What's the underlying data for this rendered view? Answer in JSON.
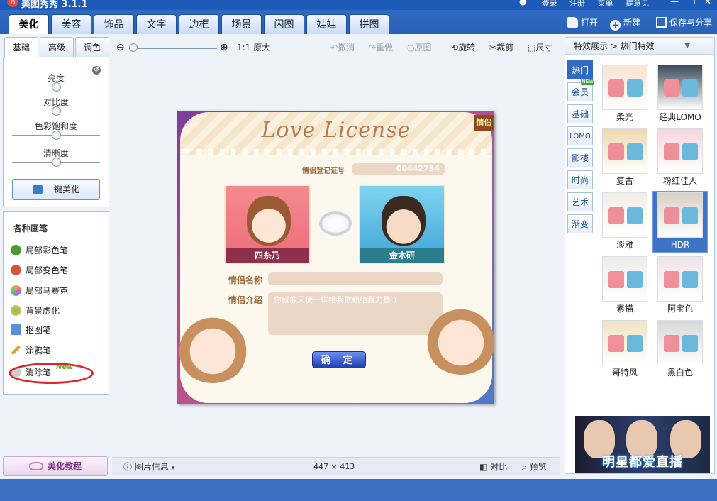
{
  "window": {
    "title": "美图秀秀 3.1.1",
    "top_links": [
      "登录",
      "注册",
      "菜单",
      "提意见"
    ]
  },
  "main_tabs": [
    {
      "label": "美化",
      "active": true
    },
    {
      "label": "美容"
    },
    {
      "label": "饰品"
    },
    {
      "label": "文字"
    },
    {
      "label": "边框"
    },
    {
      "label": "场景"
    },
    {
      "label": "闪图"
    },
    {
      "label": "娃娃"
    },
    {
      "label": "拼图"
    }
  ],
  "top_actions": {
    "open": "打开",
    "new": "新建",
    "save_share": "保存与分享"
  },
  "left_panel": {
    "sub_tabs": [
      "基础",
      "高级",
      "调色"
    ],
    "sliders": [
      {
        "label": "亮度",
        "level": 0.5
      },
      {
        "label": "对比度",
        "level": 0.5
      },
      {
        "label": "色彩饱和度",
        "level": 0.5
      },
      {
        "label": "清晰度",
        "level": 0.5
      }
    ],
    "one_click": "一键美化",
    "brush_title": "各种画笔",
    "brushes": [
      {
        "label": "局部彩色笔",
        "icon": "color-brush-icon",
        "color": "#4b9a2d"
      },
      {
        "label": "局部变色笔",
        "icon": "recolor-hand-icon",
        "color": "#d8533a"
      },
      {
        "label": "局部马赛克",
        "icon": "mosaic-icon",
        "color": "#f0a13a"
      },
      {
        "label": "背景虚化",
        "icon": "blur-icon",
        "color": "#7cc45a"
      },
      {
        "label": "抠图笔",
        "icon": "cutout-icon",
        "color": "#5a8fd8"
      },
      {
        "label": "涂鸦笔",
        "icon": "doodle-pen-icon",
        "color": "#e6a422"
      },
      {
        "label": "消除笔",
        "icon": "eraser-pen-icon",
        "color": "#bbbbbb",
        "badge": "New"
      }
    ],
    "tutorial": "美化教程"
  },
  "toolbar": {
    "actual_size": "1:1 原大",
    "undo": "撤消",
    "redo": "重做",
    "original": "原图",
    "rotate": "旋转",
    "crop": "裁剪",
    "resize": "尺寸"
  },
  "photo": {
    "title": "Love License",
    "cert_label": "情侣登记证号",
    "cert_number": "00442734",
    "left_name": "四糸乃",
    "right_name": "金木研",
    "couple_name_label": "情侣名称",
    "couple_intro_label": "情侣介绍",
    "intro_text": "你就像天使一样给我依赖给我力量:)",
    "confirm": "确 定",
    "corner_text": "情侣"
  },
  "status_bar": {
    "image_info": "图片信息",
    "dimensions": "447 × 413",
    "compare": "对比",
    "preview": "预览"
  },
  "right_panel": {
    "header": "特效展示 > 热门特效",
    "categories": [
      {
        "label": "热门",
        "active": true
      },
      {
        "label": "会员",
        "badge": "NEW"
      },
      {
        "label": "基础"
      },
      {
        "label": "LOMO"
      },
      {
        "label": "影楼"
      },
      {
        "label": "时尚"
      },
      {
        "label": "艺术"
      },
      {
        "label": "渐变"
      }
    ],
    "effects": [
      {
        "label": "柔光",
        "tint": "#f7e3d1"
      },
      {
        "label": "经典LOMO",
        "tint": "#3c4a5a"
      },
      {
        "label": "复古",
        "tint": "#f0d8b0"
      },
      {
        "label": "粉红佳人",
        "tint": "#f5d6dc"
      },
      {
        "label": "淡雅",
        "tint": "#f4ede6"
      },
      {
        "label": "HDR",
        "tint": "#d9cfc3",
        "selected": true
      },
      {
        "label": "素描",
        "tint": "#ececec"
      },
      {
        "label": "阿宝色",
        "tint": "#efe3e8"
      },
      {
        "label": "哥特风",
        "tint": "#f2e2c2"
      },
      {
        "label": "黑白色",
        "tint": "#d8d8d8"
      }
    ],
    "ad_text": "明星都爱直播"
  }
}
